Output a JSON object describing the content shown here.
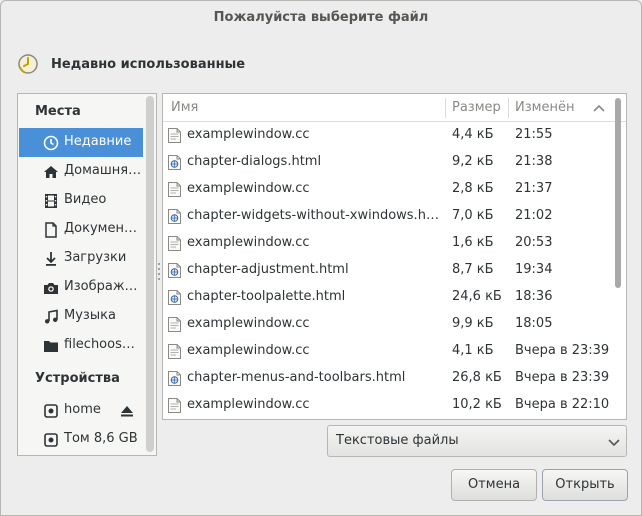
{
  "window": {
    "title": "Пожалуйста выберите файл"
  },
  "location": {
    "label": "Недавно использованные",
    "icon": "clock-icon"
  },
  "sidebar": {
    "places_heading": "Места",
    "devices_heading": "Устройства",
    "places": [
      {
        "label": "Недавние",
        "icon": "clock-icon",
        "selected": true
      },
      {
        "label": "Домашня…",
        "icon": "home-icon"
      },
      {
        "label": "Видео",
        "icon": "film-icon"
      },
      {
        "label": "Докумен…",
        "icon": "document-icon"
      },
      {
        "label": "Загрузки",
        "icon": "download-icon"
      },
      {
        "label": "Изображ…",
        "icon": "camera-icon"
      },
      {
        "label": "Музыка",
        "icon": "music-icon"
      },
      {
        "label": "filechoos…",
        "icon": "folder-icon"
      }
    ],
    "devices": [
      {
        "label": "home",
        "icon": "drive-icon",
        "extra_icon": "eject-icon"
      },
      {
        "label": "Том 8,6 GB",
        "icon": "drive-icon"
      }
    ]
  },
  "filelist": {
    "columns": {
      "name": "Имя",
      "size": "Размер",
      "modified": "Изменён"
    },
    "sort_icon": "chevron-up-icon",
    "rows": [
      {
        "name": "examplewindow.cc",
        "size": "4,4 кБ",
        "modified": "21:55",
        "type": "text"
      },
      {
        "name": "chapter-dialogs.html",
        "size": "9,2 кБ",
        "modified": "21:38",
        "type": "html"
      },
      {
        "name": "examplewindow.cc",
        "size": "2,8 кБ",
        "modified": "21:37",
        "type": "text"
      },
      {
        "name": "chapter-widgets-without-xwindows.html",
        "size": "7,0 кБ",
        "modified": "21:02",
        "type": "html"
      },
      {
        "name": "examplewindow.cc",
        "size": "1,6 кБ",
        "modified": "20:53",
        "type": "text"
      },
      {
        "name": "chapter-adjustment.html",
        "size": "8,7 кБ",
        "modified": "19:34",
        "type": "html"
      },
      {
        "name": "chapter-toolpalette.html",
        "size": "24,6 кБ",
        "modified": "18:36",
        "type": "html"
      },
      {
        "name": "examplewindow.cc",
        "size": "9,9 кБ",
        "modified": "18:05",
        "type": "text"
      },
      {
        "name": "examplewindow.cc",
        "size": "4,1 кБ",
        "modified": "Вчера в 23:39",
        "type": "text"
      },
      {
        "name": "chapter-menus-and-toolbars.html",
        "size": "26,8 кБ",
        "modified": "Вчера в 23:39",
        "type": "html"
      },
      {
        "name": "examplewindow.cc",
        "size": "10,2 кБ",
        "modified": "Вчера в 22:10",
        "type": "text"
      }
    ]
  },
  "filter": {
    "selected": "Текстовые файлы"
  },
  "buttons": {
    "cancel": "Отмена",
    "open": "Открыть"
  },
  "colors": {
    "selection": "#4a90d9",
    "background": "#ededed"
  }
}
